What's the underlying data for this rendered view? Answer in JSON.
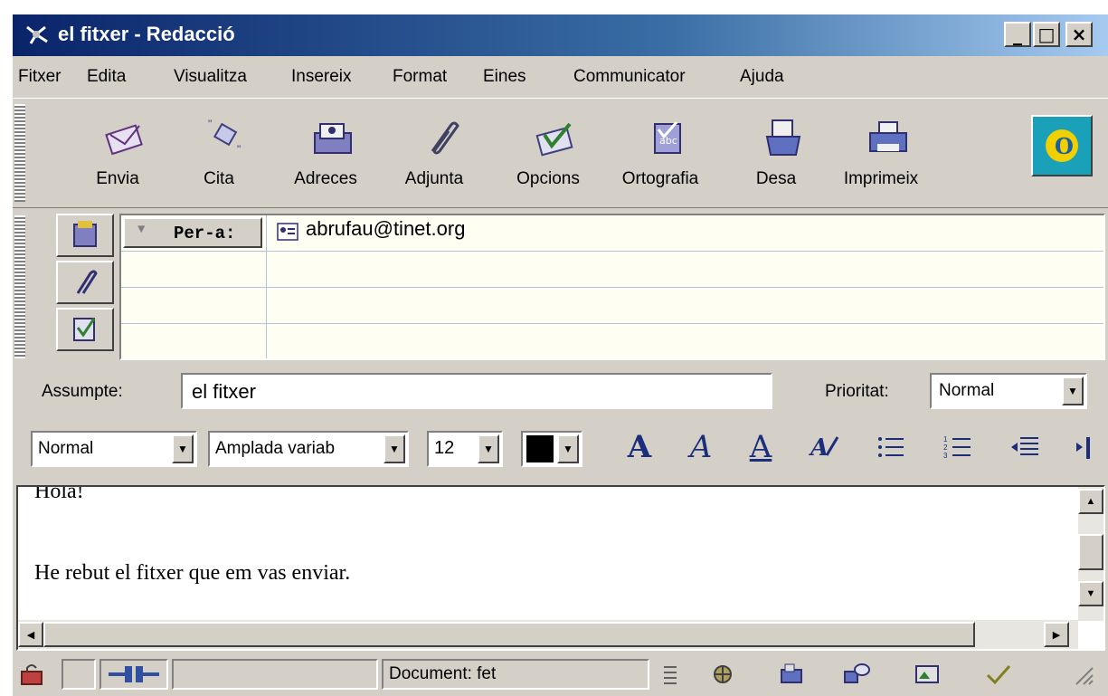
{
  "window": {
    "title": "el fitxer - Redacció",
    "minimize": "_",
    "maximize": "□",
    "close": "×"
  },
  "menu": [
    "Fitxer",
    "Edita",
    "Visualitza",
    "Insereix",
    "Format",
    "Eines",
    "Communicator",
    "Ajuda"
  ],
  "toolbar": {
    "send": "Envia",
    "quote": "Cita",
    "addresses": "Adreces",
    "attach": "Adjunta",
    "options": "Opcions",
    "spelling": "Ortografia",
    "save": "Desa",
    "print": "Imprimeix",
    "logo_letter": "O"
  },
  "address": {
    "to_label": "Per-a:",
    "to_value": "abrufau@tinet.org"
  },
  "subject": {
    "label": "Assumpte:",
    "value": "el fitxer",
    "priority_label": "Prioritat:",
    "priority_value": "Normal"
  },
  "format": {
    "paragraph_style": "Normal",
    "font": "Amplada variab",
    "size": "12",
    "bold_glyph": "A",
    "italic_glyph": "A",
    "underline_glyph": "A",
    "text_color": "#000000"
  },
  "body": {
    "line1": "Hola!",
    "line2": "He rebut el fitxer que em vas enviar."
  },
  "status": {
    "text": "Document: fet"
  },
  "colors": {
    "titlebar_start": "#0a246a",
    "titlebar_end": "#a6caf0",
    "window_face": "#d4d0c8",
    "format_icon": "#1a2e7a"
  }
}
